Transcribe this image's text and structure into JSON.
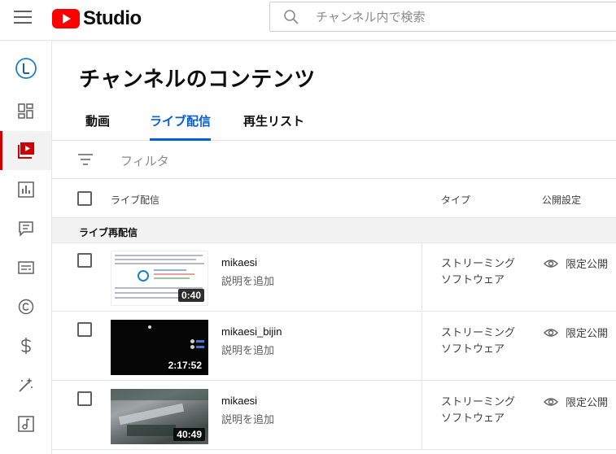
{
  "header": {
    "app_name": "Studio",
    "search_placeholder": "チャンネル内で検索"
  },
  "sidebar": {
    "items": [
      {
        "icon": "channel-avatar-icon"
      },
      {
        "icon": "dashboard-icon"
      },
      {
        "icon": "content-icon",
        "active": true
      },
      {
        "icon": "analytics-icon"
      },
      {
        "icon": "comments-icon"
      },
      {
        "icon": "subtitles-icon"
      },
      {
        "icon": "copyright-icon"
      },
      {
        "icon": "monetization-icon"
      },
      {
        "icon": "customization-icon"
      },
      {
        "icon": "audio-library-icon"
      }
    ]
  },
  "page": {
    "title": "チャンネルのコンテンツ"
  },
  "tabs": [
    {
      "label": "動画"
    },
    {
      "label": "ライブ配信",
      "active": true
    },
    {
      "label": "再生リスト"
    }
  ],
  "filter": {
    "placeholder": "フィルタ"
  },
  "table": {
    "headers": {
      "live": "ライブ配信",
      "type": "タイプ",
      "visibility": "公開設定"
    },
    "section_label": "ライブ再配信",
    "rows": [
      {
        "title": "mikaesi",
        "description": "説明を追加",
        "duration": "0:40",
        "type_line1": "ストリーミング",
        "type_line2": "ソフトウェア",
        "visibility": "限定公開"
      },
      {
        "title": "mikaesi_bijin",
        "description": "説明を追加",
        "duration": "2:17:52",
        "type_line1": "ストリーミング",
        "type_line2": "ソフトウェア",
        "visibility": "限定公開"
      },
      {
        "title": "mikaesi",
        "description": "説明を追加",
        "duration": "40:49",
        "type_line1": "ストリーミング",
        "type_line2": "ソフトウェア",
        "visibility": "限定公開"
      }
    ]
  },
  "colors": {
    "accent": "#065fd4",
    "brand": "#ff0000",
    "active_indicator": "#cc0000"
  }
}
